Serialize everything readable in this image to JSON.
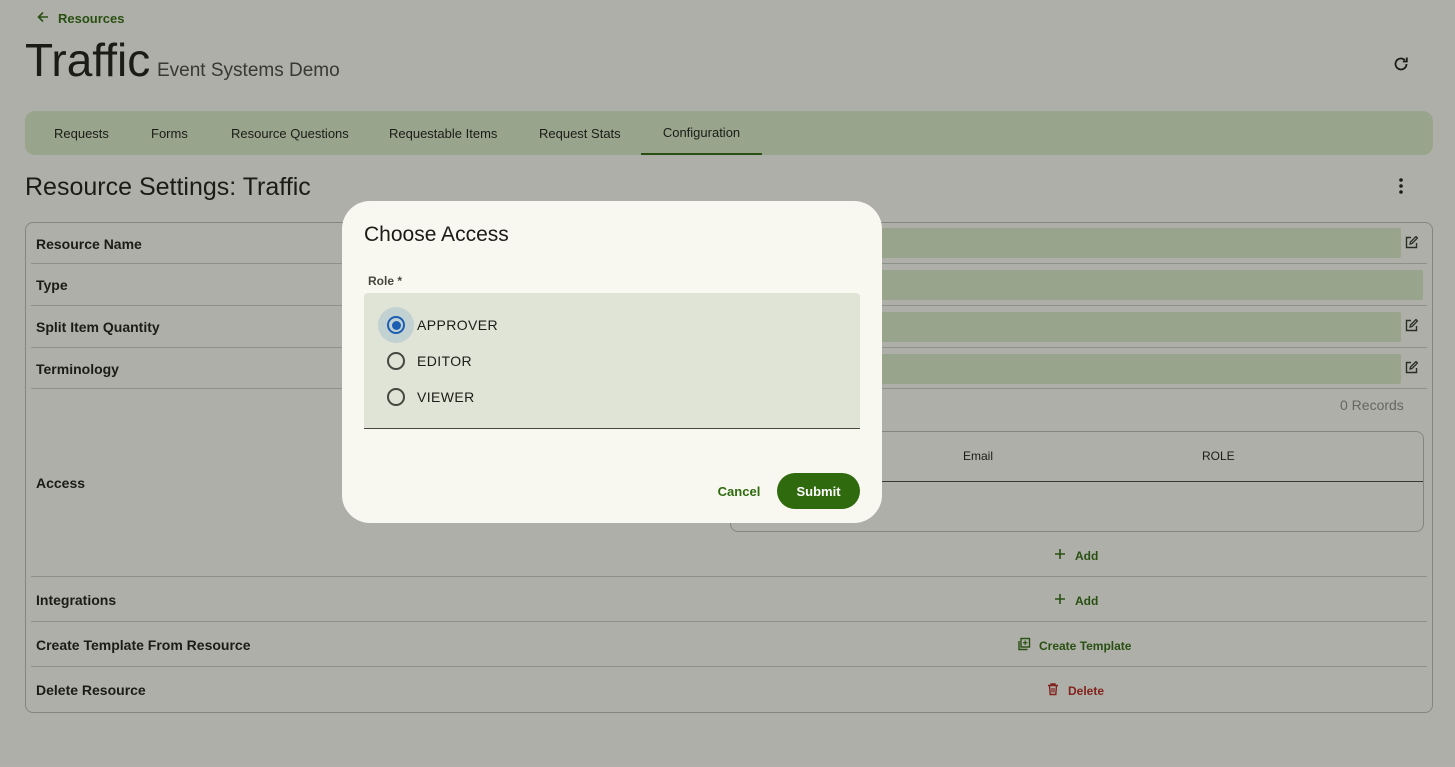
{
  "header": {
    "back_label": "Resources",
    "title": "Traffic",
    "subtitle": "Event Systems Demo"
  },
  "tabs": [
    {
      "label": "Requests",
      "active": false
    },
    {
      "label": "Forms",
      "active": false
    },
    {
      "label": "Resource Questions",
      "active": false
    },
    {
      "label": "Requestable Items",
      "active": false
    },
    {
      "label": "Request Stats",
      "active": false
    },
    {
      "label": "Configuration",
      "active": true
    }
  ],
  "settings": {
    "title": "Resource Settings: Traffic",
    "rows": {
      "resource_name": "Resource Name",
      "type": "Type",
      "split_item_quantity": "Split Item Quantity",
      "terminology": "Terminology",
      "access": "Access",
      "integrations": "Integrations",
      "create_template": "Create Template From Resource",
      "delete_resource": "Delete Resource"
    },
    "access_table": {
      "records": "0 Records",
      "col_email": "Email",
      "col_role": "ROLE",
      "add_label": "Add"
    },
    "integrations_add_label": "Add",
    "create_template_label": "Create Template",
    "delete_label": "Delete"
  },
  "dialog": {
    "title": "Choose Access",
    "role_label": "Role *",
    "options": [
      {
        "label": "APPROVER",
        "selected": true
      },
      {
        "label": "EDITOR",
        "selected": false
      },
      {
        "label": "VIEWER",
        "selected": false
      }
    ],
    "cancel_label": "Cancel",
    "submit_label": "Submit"
  },
  "colors": {
    "primary": "#2f6a0f",
    "tab_bg": "#d6e8c4",
    "danger": "#b3261e",
    "radio_selected": "#1a5fb4"
  },
  "icons": {
    "back": "arrow-left-icon",
    "refresh": "refresh-icon",
    "more": "more-vert-icon",
    "edit": "edit-icon",
    "add": "plus-icon",
    "template": "copy-icon",
    "delete": "trash-icon"
  }
}
